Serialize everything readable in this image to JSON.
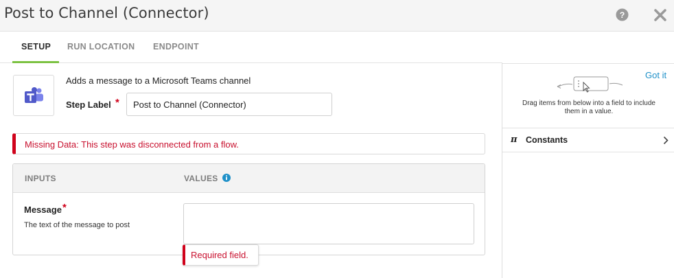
{
  "window": {
    "title": "Post to Channel (Connector)",
    "help_icon": "question-circle-icon",
    "close_icon": "close-x-icon"
  },
  "tabs": [
    {
      "label": "SETUP",
      "active": true
    },
    {
      "label": "RUN LOCATION",
      "active": false
    },
    {
      "label": "ENDPOINT",
      "active": false
    }
  ],
  "step": {
    "app_icon": "microsoft-teams-icon",
    "description": "Adds a message to a Microsoft Teams channel",
    "label_title": "Step Label",
    "required_marker": "*",
    "label_value": "Post to Channel (Connector)"
  },
  "alert": {
    "text": "Missing Data: This step was disconnected from a flow."
  },
  "inputs_table": {
    "col_inputs": "INPUTS",
    "col_values": "VALUES",
    "rows": [
      {
        "name": "Message",
        "required_marker": "*",
        "help": "The text of the message to post",
        "value": "",
        "error": "Required field."
      }
    ]
  },
  "sidebar": {
    "got_it": "Got it",
    "drag_hint": "Drag items from below into a field to include them in a value.",
    "constants_label": "Constants"
  },
  "colors": {
    "accent_green": "#7cc242",
    "error_red": "#d0021b",
    "link_blue": "#1e90c8",
    "teams_purple": "#5059c9"
  }
}
